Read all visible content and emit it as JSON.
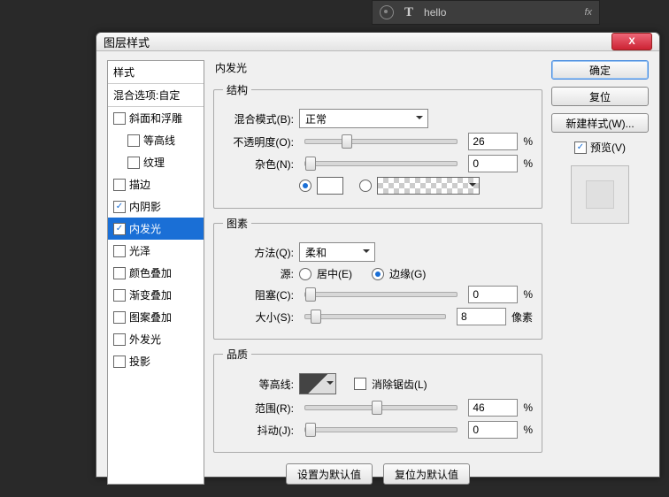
{
  "psbar": {
    "layer_name": "hello",
    "T": "T",
    "fx": "fx"
  },
  "dialog_title": "图层样式",
  "close_x": "X",
  "styles": {
    "head": "样式",
    "blendopts": "混合选项:自定",
    "bevel": "斜面和浮雕",
    "contour": "等高线",
    "texture": "纹理",
    "stroke": "描边",
    "innershadow": "内阴影",
    "innerglow": "内发光",
    "satin": "光泽",
    "coloroverlay": "颜色叠加",
    "gradoverlay": "渐变叠加",
    "patoverlay": "图案叠加",
    "outerglow": "外发光",
    "dropshadow": "投影"
  },
  "panel": {
    "title": "内发光"
  },
  "struct": {
    "legend": "结构",
    "blendmode_l": "混合模式(B):",
    "blendmode_v": "正常",
    "opacity_l": "不透明度(O):",
    "opacity_v": "26",
    "noise_l": "杂色(N):",
    "noise_v": "0",
    "pct": "%"
  },
  "elem": {
    "legend": "图素",
    "tech_l": "方法(Q):",
    "tech_v": "柔和",
    "source_l": "源:",
    "src_center": "居中(E)",
    "src_edge": "边缘(G)",
    "choke_l": "阻塞(C):",
    "choke_v": "0",
    "size_l": "大小(S):",
    "size_v": "8",
    "px": "像素",
    "pct": "%"
  },
  "quality": {
    "legend": "品质",
    "contour_l": "等高线:",
    "antialias": "消除锯齿(L)",
    "range_l": "范围(R):",
    "range_v": "46",
    "jitter_l": "抖动(J):",
    "jitter_v": "0",
    "pct": "%"
  },
  "defaults": {
    "set": "设置为默认值",
    "reset": "复位为默认值"
  },
  "right": {
    "ok": "确定",
    "cancel": "复位",
    "newstyle": "新建样式(W)...",
    "preview": "预览(V)"
  }
}
